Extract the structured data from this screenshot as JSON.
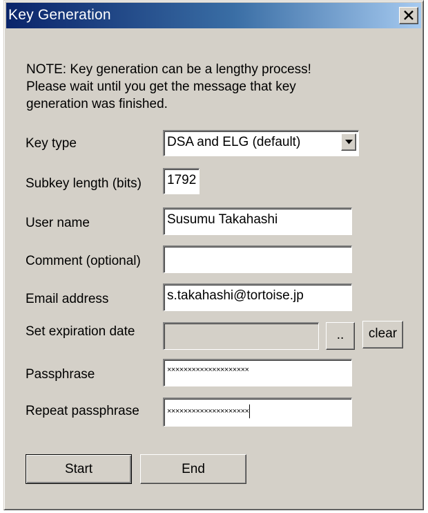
{
  "window": {
    "title": "Key Generation",
    "close_symbol": "×"
  },
  "note": "NOTE: Key generation can be a lengthy process!\nPlease wait until you get the message that key\ngeneration was finished.",
  "form": {
    "key_type": {
      "label": "Key type",
      "value": "DSA and ELG (default)"
    },
    "subkey_length": {
      "label": "Subkey length (bits)",
      "value": "1792"
    },
    "user_name": {
      "label": "User name",
      "value": "Susumu Takahashi"
    },
    "comment": {
      "label": "Comment (optional)",
      "value": ""
    },
    "email": {
      "label": "Email address",
      "value": "s.takahashi@tortoise.jp"
    },
    "expiration": {
      "label": "Set expiration date",
      "value": "",
      "browse_label": "..",
      "clear_label": "clear"
    },
    "passphrase": {
      "label": "Passphrase",
      "value": "××××××××××××××××××××"
    },
    "repeat_passphrase": {
      "label": "Repeat passphrase",
      "value": "××××××××××××××××××××"
    }
  },
  "buttons": {
    "start": "Start",
    "end": "End"
  },
  "icons": {
    "close": "close-icon",
    "dropdown": "chevron-down-icon"
  },
  "colors": {
    "titlebar_start": "#0a246a",
    "titlebar_end": "#a6caf0",
    "face": "#d4d0c8"
  }
}
